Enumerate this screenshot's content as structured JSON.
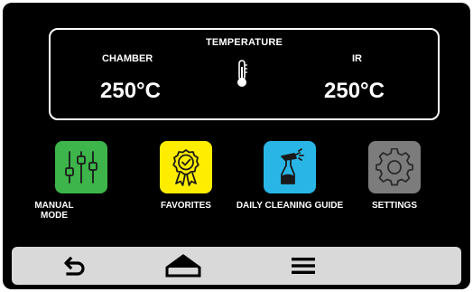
{
  "temperature": {
    "title": "TEMPERATURE",
    "chamber": {
      "label": "CHAMBER",
      "value": "250°C"
    },
    "ir": {
      "label": "IR",
      "value": "250°C"
    },
    "icon": "thermometer-icon"
  },
  "menu": {
    "items": [
      {
        "label": "MANUAL MODE",
        "icon": "sliders-icon",
        "color": "#3db54a"
      },
      {
        "label": "FAVORITES",
        "icon": "award-ribbon-icon",
        "color": "#ffed00"
      },
      {
        "label": "DAILY CLEANING GUIDE",
        "icon": "spray-bottle-icon",
        "color": "#29b6e6"
      },
      {
        "label": "SETTINGS",
        "icon": "gear-icon",
        "color": "#7c7c7c"
      }
    ]
  },
  "navbar": {
    "items": [
      {
        "icon": "back-icon"
      },
      {
        "icon": "home-icon"
      },
      {
        "icon": "menu-icon"
      }
    ]
  },
  "colors": {
    "background": "#000000",
    "panel_border": "#ffffff",
    "navbar": "#d9d9d9"
  }
}
